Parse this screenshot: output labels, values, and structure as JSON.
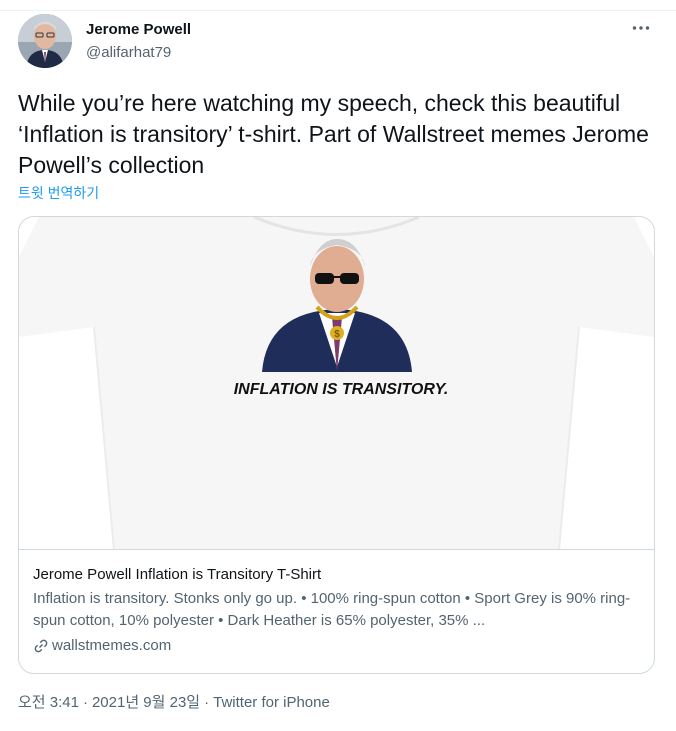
{
  "author": {
    "display_name": "Jerome Powell",
    "handle": "@alifarhat79"
  },
  "tweet": {
    "text": "While you’re here watching my speech, check this beautiful ‘Inflation is transitory’ t-shirt. Part of Wallstreet memes Jerome Powell’s collection",
    "translate_label": "트윗 번역하기"
  },
  "card": {
    "shirt_caption": "INFLATION IS TRANSITORY.",
    "title": "Jerome Powell Inflation is Transitory T-Shirt",
    "description": "Inflation is transitory. Stonks only go up. • 100% ring-spun cotton • Sport Grey is 90% ring-spun cotton, 10% polyester • Dark Heather is 65% polyester, 35% ...",
    "domain": "wallstmemes.com"
  },
  "meta": {
    "time": "오전 3:41",
    "date": "2021년 9월 23일",
    "separator": "·",
    "source": "Twitter for iPhone"
  },
  "icons": {
    "more": "more-horizontal-icon",
    "link": "link-icon"
  }
}
